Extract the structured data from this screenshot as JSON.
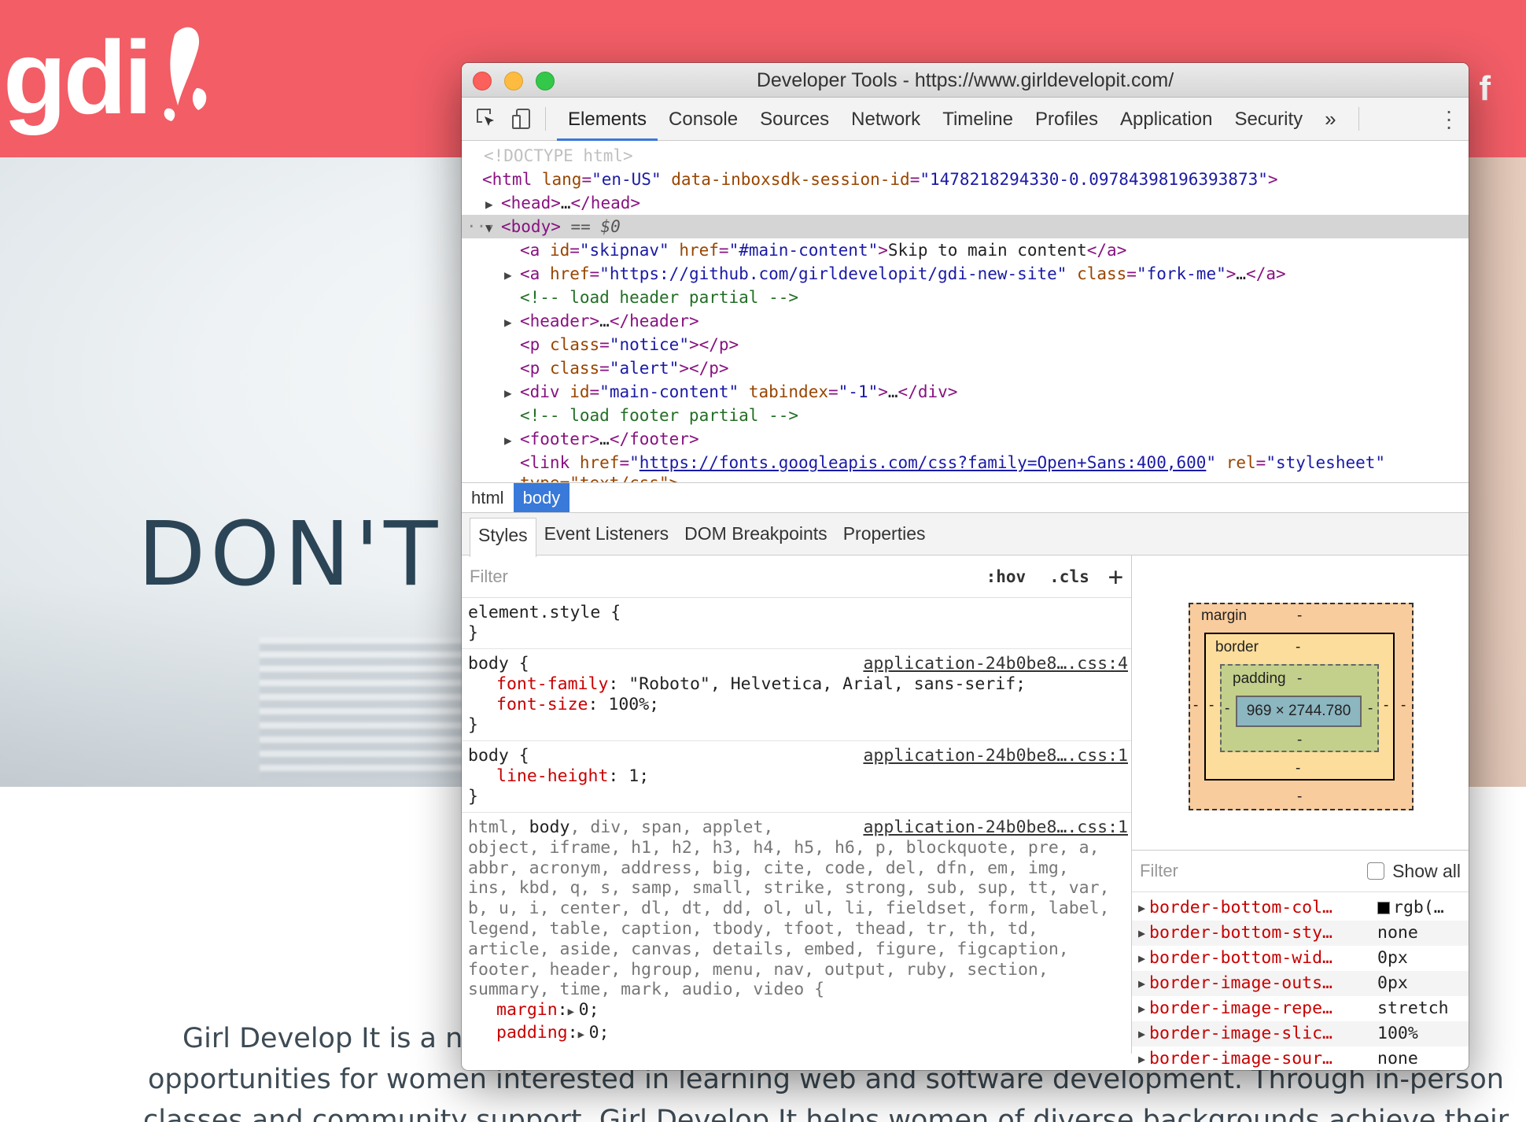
{
  "site": {
    "hero_title": "DON'T B",
    "body_line1": "Girl Develop It is a non",
    "body_line2": "opportunities for women interested in learning web and software development. Through in-person",
    "body_line3": "classes and community support, Girl Develop It helps women of diverse backgrounds achieve their",
    "facebook_icon": "facebook-icon",
    "logo": "gdi"
  },
  "devtools": {
    "title": "Developer Tools - https://www.girldevelopit.com/",
    "tabs": [
      "Elements",
      "Console",
      "Sources",
      "Network",
      "Timeline",
      "Profiles",
      "Application",
      "Security"
    ],
    "more_tabs": "»",
    "dom": {
      "doctype": "<!DOCTYPE html>",
      "html_lang_val": "\"en-US\"",
      "html_session_val": "\"1478218294330-0.09784398196393873\"",
      "body_eq": "== $0",
      "skipnav_id": "\"skipnav\"",
      "skipnav_href": "\"#main-content\"",
      "skipnav_text": "Skip to main content",
      "github_href": "\"https://github.com/girldevelopit/gdi-new-site\"",
      "github_class": "\"fork-me\"",
      "comment_header": "<!--    load header partial -->",
      "notice_class": "\"notice\"",
      "alert_class": "\"alert\"",
      "main_id": "\"main-content\"",
      "main_tabindex": "\"-1\"",
      "comment_footer": "<!-- load footer partial -->",
      "link_href": "https://fonts.googleapis.com/css?family=Open+Sans:400,600",
      "link_rel": "\"stylesheet\"",
      "link_type": "type=\"text/css\">"
    },
    "breadcrumbs": [
      "html",
      "body"
    ],
    "subtabs": [
      "Styles",
      "Event Listeners",
      "DOM Breakpoints",
      "Properties"
    ],
    "styles": {
      "filter_placeholder": "Filter",
      "hov": ":hov",
      "cls": ".cls",
      "plus": "+",
      "element_style": "element.style {",
      "close_brace": "}",
      "rule1_selector": "body {",
      "rule1_source": "application-24b0be8….css:4",
      "rule1_props": [
        {
          "name": "font-family",
          "value": "\"Roboto\", Helvetica, Arial, sans-serif;"
        },
        {
          "name": "font-size",
          "value": "100%;"
        }
      ],
      "rule2_selector": "body {",
      "rule2_source": "application-24b0be8….css:1",
      "rule2_props": [
        {
          "name": "line-height",
          "value": "1;"
        }
      ],
      "rule3_source": "application-24b0be8….css:1",
      "rule3_sel_a": "html, ",
      "rule3_sel_b": "body",
      "rule3_sel_c": ", div, span, applet,",
      "rule3_lines": [
        "object, iframe, h1, h2, h3, h4, h5, h6, p, blockquote, pre, a,",
        "abbr, acronym, address, big, cite, code, del, dfn, em, img,",
        "ins, kbd, q, s, samp, small, strike, strong, sub, sup, tt, var,",
        "b, u, i, center, dl, dt, dd, ol, ul, li, fieldset, form, label,",
        "legend, table, caption, tbody, tfoot, thead, tr, th, td,",
        "article, aside, canvas, details, embed, figure, figcaption,",
        "footer, header, hgroup, menu, nav, output, ruby, section,",
        "summary, time, mark, audio, video {"
      ],
      "rule3_props": [
        {
          "name": "margin",
          "value": "0;"
        },
        {
          "name": "padding",
          "value": "0;"
        }
      ]
    },
    "boxmodel": {
      "margin_label": "margin",
      "border_label": "border",
      "padding_label": "padding",
      "dash": "-",
      "content_size": "969 × 2744.780"
    },
    "computed": {
      "filter_placeholder": "Filter",
      "show_all": "Show all",
      "rows": [
        {
          "name": "border-bottom-col…",
          "value": "rgb(…"
        },
        {
          "name": "border-bottom-sty…",
          "value": "none"
        },
        {
          "name": "border-bottom-wid…",
          "value": "0px"
        },
        {
          "name": "border-image-outs…",
          "value": "0px"
        },
        {
          "name": "border-image-repe…",
          "value": "stretch"
        },
        {
          "name": "border-image-slic…",
          "value": "100%"
        },
        {
          "name": "border-image-sour…",
          "value": "none"
        }
      ]
    }
  }
}
